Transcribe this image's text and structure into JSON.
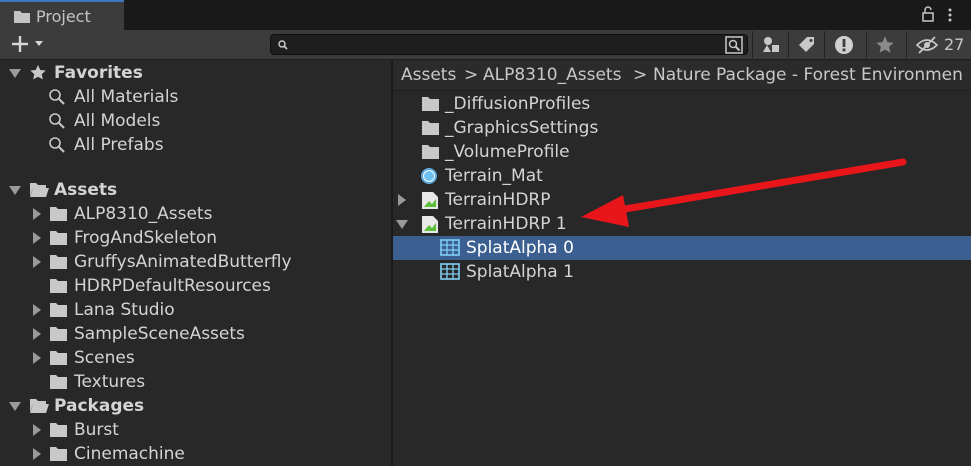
{
  "tab": {
    "title": "Project",
    "icon": "folder-icon"
  },
  "toolbar": {
    "search_value": "",
    "hidden_count": "27",
    "buttons": [
      "open-in-window-icon",
      "filter-by-type-icon",
      "filter-by-label-icon",
      "error-icon",
      "favorite-star-icon",
      "hidden-packages-icon"
    ]
  },
  "favorites": {
    "label": "Favorites",
    "items": [
      {
        "label": "All Materials"
      },
      {
        "label": "All Models"
      },
      {
        "label": "All Prefabs"
      }
    ]
  },
  "assets": {
    "label": "Assets",
    "items": [
      {
        "label": "ALP8310_Assets",
        "expandable": true
      },
      {
        "label": "FrogAndSkeleton",
        "expandable": true
      },
      {
        "label": "GruffysAnimatedButterfly",
        "expandable": true
      },
      {
        "label": "HDRPDefaultResources",
        "expandable": false
      },
      {
        "label": "Lana Studio",
        "expandable": true
      },
      {
        "label": "SampleSceneAssets",
        "expandable": true
      },
      {
        "label": "Scenes",
        "expandable": true
      },
      {
        "label": "Textures",
        "expandable": false
      }
    ]
  },
  "packages": {
    "label": "Packages",
    "items": [
      {
        "label": "Burst"
      },
      {
        "label": "Cinemachine"
      }
    ]
  },
  "breadcrumb": [
    "Assets",
    "ALP8310_Assets",
    "Nature Package - Forest Environmen"
  ],
  "breadcrumb_sep": ">",
  "files": [
    {
      "label": "_DiffusionProfiles",
      "icon": "folder-icon"
    },
    {
      "label": "_GraphicsSettings",
      "icon": "folder-icon"
    },
    {
      "label": "_VolumeProfile",
      "icon": "folder-icon"
    },
    {
      "label": "Terrain_Mat",
      "icon": "material-sphere-icon"
    },
    {
      "label": "TerrainHDRP",
      "icon": "terrain-data-icon"
    },
    {
      "label": "TerrainHDRP 1",
      "icon": "terrain-data-icon"
    },
    {
      "label": "SplatAlpha 0",
      "icon": "texture-grid-icon"
    },
    {
      "label": "SplatAlpha 1",
      "icon": "texture-grid-icon"
    }
  ],
  "colors": {
    "selection": "#3c5f91",
    "annotation_arrow": "#e8161b",
    "tab_accent": "#3a79bb"
  }
}
